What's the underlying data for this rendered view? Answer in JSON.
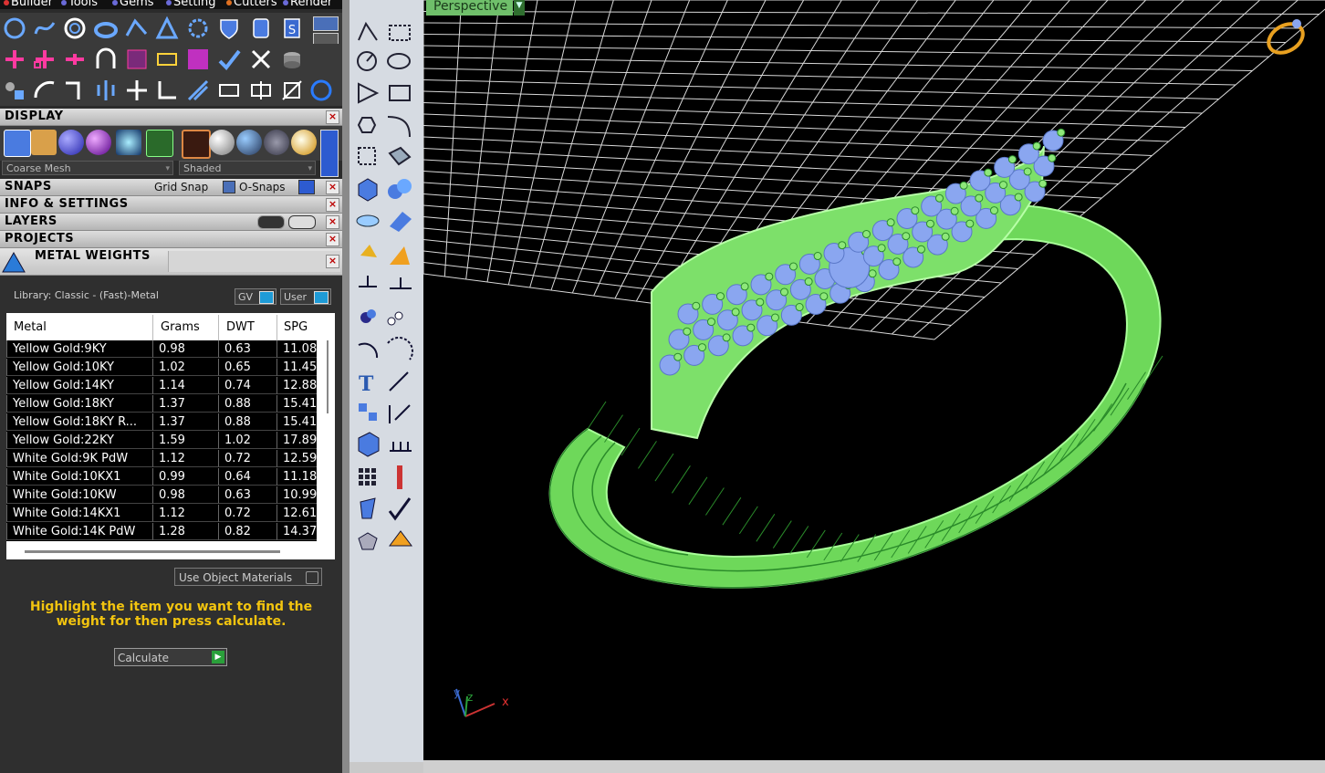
{
  "menubar": {
    "items": [
      {
        "label": "Builder",
        "dot": "#d33"
      },
      {
        "label": "Tools",
        "dot": "#6a6ad8"
      },
      {
        "label": "Gems",
        "dot": "#6a6ad8"
      },
      {
        "label": "Setting",
        "dot": "#6a6ad8"
      },
      {
        "label": "Cutters",
        "dot": "#e07020"
      },
      {
        "label": "Render",
        "dot": "#6a6ad8"
      }
    ]
  },
  "panels": {
    "display": "DISPLAY",
    "snaps": "SNAPS",
    "grid_snap": "Grid Snap",
    "o_snaps": "O-Snaps",
    "info_settings": "INFO & SETTINGS",
    "layers": "LAYERS",
    "projects": "PROJECTS",
    "metal_weights": "METAL WEIGHTS"
  },
  "display": {
    "mesh_select": "Coarse Mesh",
    "shade_select": "Shaded"
  },
  "metal_weights": {
    "library_label": "Library: Classic - (Fast)-Metal",
    "gv_button": "GV",
    "user_button": "User",
    "columns": [
      "Metal",
      "Grams",
      "DWT",
      "SPG"
    ],
    "rows": [
      {
        "metal": "Yellow Gold:9KY",
        "grams": "0.98",
        "dwt": "0.63",
        "spg": "11.08"
      },
      {
        "metal": "Yellow Gold:10KY",
        "grams": "1.02",
        "dwt": "0.65",
        "spg": "11.45"
      },
      {
        "metal": "Yellow Gold:14KY",
        "grams": "1.14",
        "dwt": "0.74",
        "spg": "12.88"
      },
      {
        "metal": "Yellow Gold:18KY",
        "grams": "1.37",
        "dwt": "0.88",
        "spg": "15.41"
      },
      {
        "metal": "Yellow Gold:18KY R...",
        "grams": "1.37",
        "dwt": "0.88",
        "spg": "15.41"
      },
      {
        "metal": "Yellow Gold:22KY",
        "grams": "1.59",
        "dwt": "1.02",
        "spg": "17.89"
      },
      {
        "metal": "White Gold:9K PdW",
        "grams": "1.12",
        "dwt": "0.72",
        "spg": "12.59"
      },
      {
        "metal": "White Gold:10KX1",
        "grams": "0.99",
        "dwt": "0.64",
        "spg": "11.18"
      },
      {
        "metal": "White Gold:10KW",
        "grams": "0.98",
        "dwt": "0.63",
        "spg": "10.99"
      },
      {
        "metal": "White Gold:14KX1",
        "grams": "1.12",
        "dwt": "0.72",
        "spg": "12.61"
      },
      {
        "metal": "White Gold:14K PdW",
        "grams": "1.28",
        "dwt": "0.82",
        "spg": "14.37"
      }
    ],
    "use_object_materials": "Use Object Materials",
    "hint": "Highlight the item you want to find the weight for then press calculate.",
    "calculate": "Calculate"
  },
  "viewport": {
    "label": "Perspective",
    "axis_x": "x",
    "axis_y": "y",
    "axis_z": "z"
  },
  "colors": {
    "mesh_green": "#8ee87a",
    "gem_blue": "#8aa6f0",
    "hint_yellow": "#f2c40f"
  }
}
